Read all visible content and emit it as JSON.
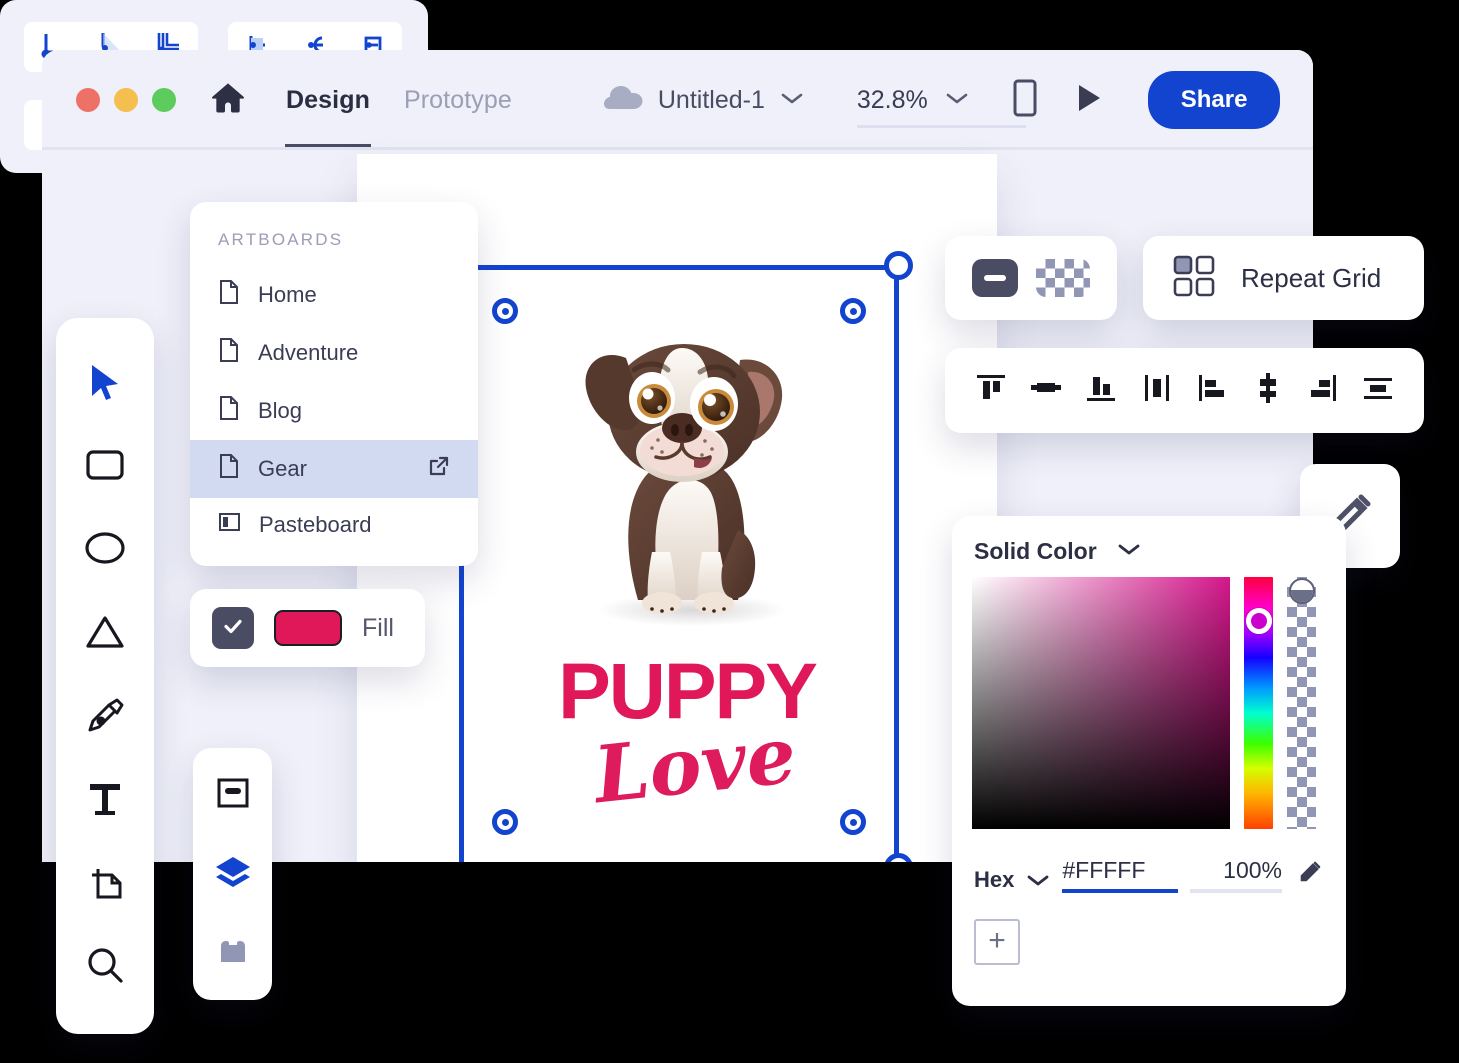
{
  "window": {
    "titlebar": {
      "traffic_lights": [
        "close",
        "minimize",
        "maximize"
      ],
      "home_icon": "home-icon",
      "tabs": [
        {
          "label": "Design",
          "active": true
        },
        {
          "label": "Prototype",
          "active": false
        }
      ],
      "cloud_icon": "cloud-icon",
      "document_name": "Untitled-1",
      "document_chevron": "chevron-down-icon",
      "zoom_level": "32.8%",
      "zoom_chevron": "chevron-down-icon",
      "device_preview_icon": "mobile-device-icon",
      "play_icon": "play-triangle-icon",
      "share_label": "Share"
    }
  },
  "artboards_panel": {
    "title": "ARTBOARDS",
    "items": [
      {
        "label": "Home",
        "icon": "document-icon",
        "selected": false,
        "external": false
      },
      {
        "label": "Adventure",
        "icon": "document-icon",
        "selected": false,
        "external": false
      },
      {
        "label": "Blog",
        "icon": "document-icon",
        "selected": false,
        "external": false
      },
      {
        "label": "Gear",
        "icon": "document-icon",
        "selected": true,
        "external": true
      },
      {
        "label": "Pasteboard",
        "icon": "pasteboard-icon",
        "selected": false,
        "external": false
      }
    ]
  },
  "fill_card": {
    "checkbox_checked": true,
    "swatch_color": "#e0185a",
    "label": "Fill"
  },
  "tool_rail": {
    "tools": [
      {
        "name": "select-tool",
        "icon": "cursor-arrow-icon",
        "active": true
      },
      {
        "name": "rectangle-tool",
        "icon": "rectangle-icon",
        "active": false
      },
      {
        "name": "ellipse-tool",
        "icon": "ellipse-icon",
        "active": false
      },
      {
        "name": "polygon-tool",
        "icon": "triangle-icon",
        "active": false
      },
      {
        "name": "pen-tool",
        "icon": "pen-nib-icon",
        "active": false
      },
      {
        "name": "text-tool",
        "icon": "text-t-icon",
        "active": false
      },
      {
        "name": "artboard-tool",
        "icon": "artboard-icon",
        "active": false
      },
      {
        "name": "zoom-tool",
        "icon": "magnifier-icon",
        "active": false
      }
    ]
  },
  "panels_rail": {
    "items": [
      {
        "name": "properties-panel",
        "icon": "properties-icon",
        "active": false
      },
      {
        "name": "layers-panel",
        "icon": "layers-stack-icon",
        "active": true
      },
      {
        "name": "components-panel",
        "icon": "components-icon",
        "active": false
      }
    ]
  },
  "appearance_card": {
    "solid_icon": "solid-fill-icon",
    "transparent_icon": "checkerboard-transparency-icon"
  },
  "repeat_grid_card": {
    "icon": "repeat-grid-icon",
    "label": "Repeat Grid"
  },
  "align_toolbar": {
    "buttons": [
      {
        "name": "align-top",
        "icon": "align-top-icon"
      },
      {
        "name": "align-vertical-center",
        "icon": "align-vertical-center-icon"
      },
      {
        "name": "align-bottom",
        "icon": "align-bottom-icon"
      },
      {
        "name": "align-horizontal-center",
        "icon": "align-horizontal-center-icon"
      },
      {
        "name": "align-left",
        "icon": "align-left-icon"
      },
      {
        "name": "distribute-vertical",
        "icon": "distribute-vertical-icon"
      },
      {
        "name": "align-right",
        "icon": "align-right-icon"
      },
      {
        "name": "distribute-horizontal",
        "icon": "distribute-horizontal-icon"
      }
    ]
  },
  "eyedropper_card": {
    "icon": "eyedropper-icon"
  },
  "color_panel": {
    "mode_label": "Solid Color",
    "mode_chevron": "chevron-down-icon",
    "format_label": "Hex",
    "format_chevron": "chevron-down-icon",
    "hex_value": "#FFFFF",
    "hex_placeholder": "#FFFFFF",
    "alpha_value": "100%",
    "eyedropper_icon": "eyedropper-icon",
    "add_swatch_label": "+",
    "gradient_end_color": "#d6168c",
    "hue_thumb_color": "#cc00cc"
  },
  "stroke_card": {
    "group_joins": [
      {
        "name": "miter-join",
        "icon": "miter-join-icon",
        "active": true
      },
      {
        "name": "round-join",
        "icon": "round-join-icon",
        "active": false
      },
      {
        "name": "bevel-join",
        "icon": "bevel-join-icon",
        "active": false
      }
    ],
    "group_caps": [
      {
        "name": "butt-cap",
        "icon": "butt-cap-icon",
        "active": true
      },
      {
        "name": "round-cap",
        "icon": "round-cap-icon",
        "active": false
      },
      {
        "name": "square-cap",
        "icon": "square-cap-icon",
        "active": false
      }
    ],
    "group_corners": [
      {
        "name": "sharp-corner",
        "icon": "sharp-corner-icon",
        "active": true
      },
      {
        "name": "rounded-corner",
        "icon": "rounded-corner-icon",
        "active": false
      },
      {
        "name": "beveled-corner",
        "icon": "beveled-corner-icon",
        "active": false
      }
    ]
  },
  "artwork": {
    "image_alt": "puppy-illustration",
    "title_line1": "PUPPY",
    "title_line2": "Love",
    "title_color": "#e0185a"
  },
  "colors": {
    "accent_blue": "#1344cf",
    "window_bg": "#eff0f9",
    "selected_row": "#d2daf2",
    "dark_ui": "#4a4c63"
  }
}
